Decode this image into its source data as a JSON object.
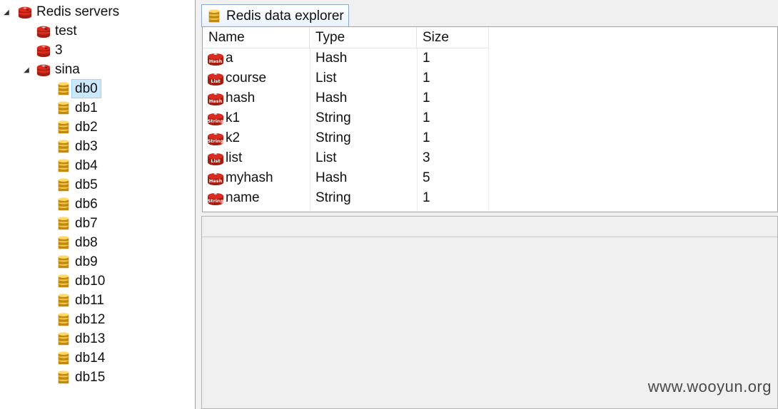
{
  "tree": {
    "root": {
      "label": "Redis servers",
      "expanded": true
    },
    "servers": [
      {
        "label": "test",
        "expanded": false
      },
      {
        "label": "3",
        "expanded": false
      },
      {
        "label": "sina",
        "expanded": true
      }
    ],
    "databases": [
      "db0",
      "db1",
      "db2",
      "db3",
      "db4",
      "db5",
      "db6",
      "db7",
      "db8",
      "db9",
      "db10",
      "db11",
      "db12",
      "db13",
      "db14",
      "db15"
    ],
    "selected": "db0"
  },
  "explorer": {
    "tab_label": "Redis data explorer",
    "columns": [
      "Name",
      "Type",
      "Size"
    ],
    "rows": [
      {
        "name": "a",
        "type": "Hash",
        "size": "1",
        "icon": "hash-icon"
      },
      {
        "name": "course",
        "type": "List",
        "size": "1",
        "icon": "list-icon"
      },
      {
        "name": "hash",
        "type": "Hash",
        "size": "1",
        "icon": "hash-icon"
      },
      {
        "name": "k1",
        "type": "String",
        "size": "1",
        "icon": "string-icon"
      },
      {
        "name": "k2",
        "type": "String",
        "size": "1",
        "icon": "string-icon"
      },
      {
        "name": "list",
        "type": "List",
        "size": "3",
        "icon": "list-icon"
      },
      {
        "name": "myhash",
        "type": "Hash",
        "size": "5",
        "icon": "hash-icon"
      },
      {
        "name": "name",
        "type": "String",
        "size": "1",
        "icon": "string-icon"
      }
    ],
    "icon_texts": {
      "hash-icon": "Hash",
      "list-icon": "List",
      "string-icon": "String"
    }
  },
  "watermark": "www.wooyun.org",
  "colors": {
    "redis_red": "#c6302b",
    "db_gold": "#d9a520",
    "selection": "#cce8ff"
  }
}
